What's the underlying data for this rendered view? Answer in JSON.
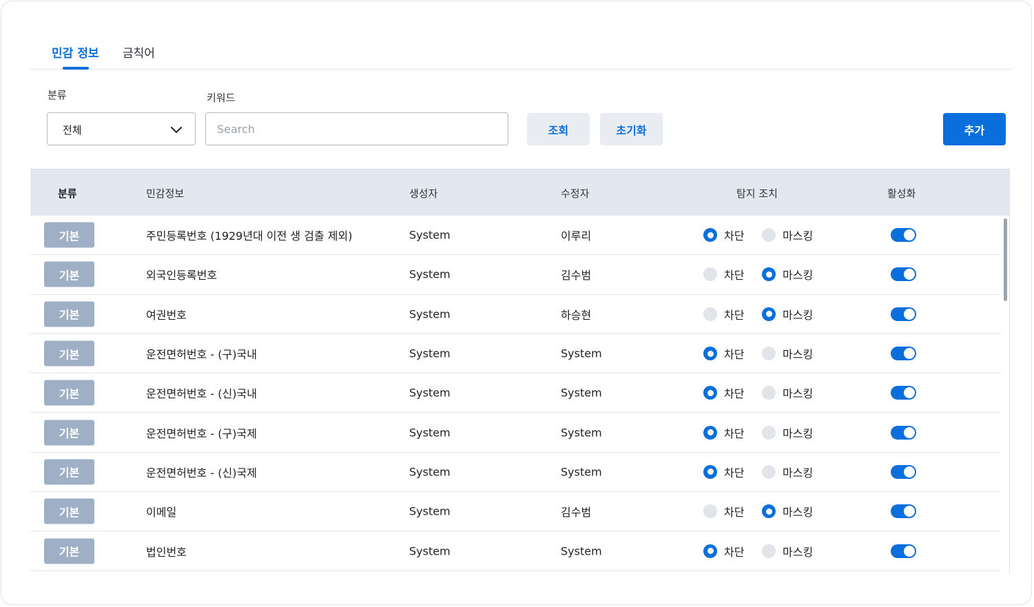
{
  "tabs": [
    {
      "label": "민감 정보",
      "active": true
    },
    {
      "label": "금칙어",
      "active": false
    }
  ],
  "filters": {
    "category_label": "분류",
    "category_value": "전체",
    "keyword_label": "키워드",
    "keyword_placeholder": "Search",
    "keyword_value": "",
    "search_button": "조회",
    "reset_button": "초기화",
    "add_button": "추가"
  },
  "table": {
    "headers": {
      "category": "분류",
      "info": "민감정보",
      "creator": "생성자",
      "modifier": "수정자",
      "action": "탐지 조치",
      "active": "활성화"
    },
    "action_options": [
      "차단",
      "마스킹"
    ],
    "rows": [
      {
        "category": "기본",
        "info": "주민등록번호 (1929년대 이전 생 검출 제외)",
        "creator": "System",
        "modifier": "이루리",
        "action": "차단",
        "enabled": true
      },
      {
        "category": "기본",
        "info": "외국인등록번호",
        "creator": "System",
        "modifier": "김수범",
        "action": "마스킹",
        "enabled": true
      },
      {
        "category": "기본",
        "info": "여권번호",
        "creator": "System",
        "modifier": "하승현",
        "action": "마스킹",
        "enabled": true
      },
      {
        "category": "기본",
        "info": "운전면허번호 - (구)국내",
        "creator": "System",
        "modifier": "System",
        "action": "차단",
        "enabled": true
      },
      {
        "category": "기본",
        "info": "운전면허번호 - (신)국내",
        "creator": "System",
        "modifier": "System",
        "action": "차단",
        "enabled": true
      },
      {
        "category": "기본",
        "info": "운전면허번호 - (구)국제",
        "creator": "System",
        "modifier": "System",
        "action": "차단",
        "enabled": true
      },
      {
        "category": "기본",
        "info": "운전면허번호 - (신)국제",
        "creator": "System",
        "modifier": "System",
        "action": "차단",
        "enabled": true
      },
      {
        "category": "기본",
        "info": "이메일",
        "creator": "System",
        "modifier": "김수범",
        "action": "마스킹",
        "enabled": true
      },
      {
        "category": "기본",
        "info": "법인번호",
        "creator": "System",
        "modifier": "System",
        "action": "차단",
        "enabled": true
      }
    ]
  },
  "colors": {
    "accent": "#0a6fdc",
    "badge": "#9fb0c6",
    "header_bg": "#e3e8f0"
  }
}
